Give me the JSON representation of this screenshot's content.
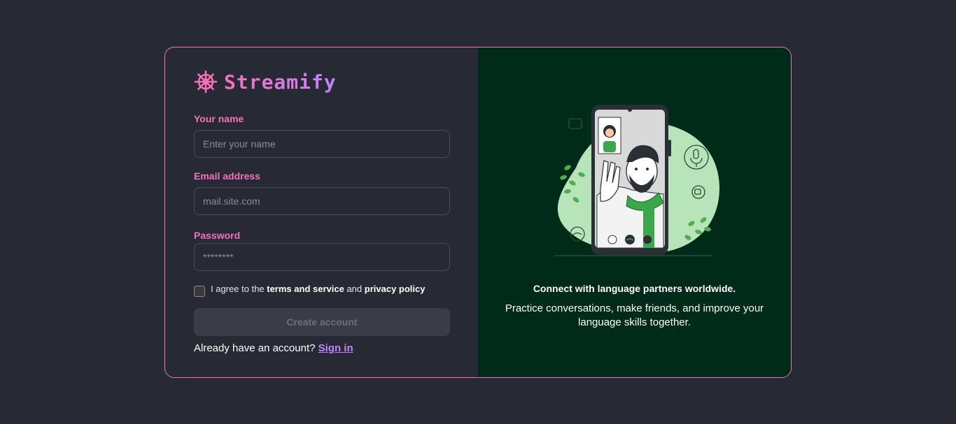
{
  "brand": {
    "name": "Streamify",
    "icon": "ship-wheel-icon",
    "gradient_start": "#f472b6",
    "gradient_end": "#c084fc"
  },
  "form": {
    "name_label": "Your name",
    "name_placeholder": "Enter your name",
    "email_label": "Email address",
    "email_placeholder": "mail.site.com",
    "password_label": "Password",
    "password_placeholder": "********",
    "terms_prefix": "I agree to the",
    "terms_link": "terms and service",
    "terms_and": "and",
    "privacy_link": "privacy policy",
    "terms_checked": false,
    "submit_label": "Create account",
    "signin_prefix": "Already have an account?",
    "signin_link": "Sign in"
  },
  "promo": {
    "title": "Connect with language partners worldwide.",
    "body": "Practice conversations, make friends, and improve your language skills together.",
    "panel_color": "#002b18"
  },
  "colors": {
    "page_bg": "#272935",
    "accent_pink": "#f472b6",
    "accent_purple": "#c084fc",
    "border": "#e879b9"
  }
}
